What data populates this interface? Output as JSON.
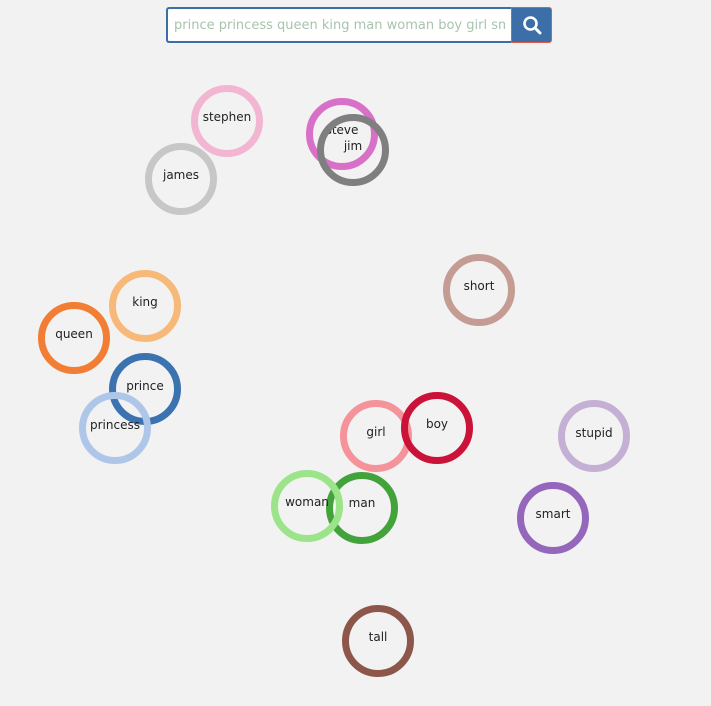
{
  "search": {
    "value": "",
    "placeholder": "prince princess queen king man woman boy girl smart stupid tall short steve jim stephen james",
    "button_icon": "search-icon"
  },
  "words": [
    {
      "id": "stephen",
      "label": "stephen",
      "color": "#f2b6d2"
    },
    {
      "id": "steve",
      "label": "steve",
      "color": "#d870c8"
    },
    {
      "id": "jim",
      "label": "jim",
      "color": "#7f7f7f"
    },
    {
      "id": "james",
      "label": "james",
      "color": "#c7c7c7"
    },
    {
      "id": "short",
      "label": "short",
      "color": "#c49c94"
    },
    {
      "id": "king",
      "label": "king",
      "color": "#f7b979"
    },
    {
      "id": "queen",
      "label": "queen",
      "color": "#f27d34"
    },
    {
      "id": "prince",
      "label": "prince",
      "color": "#3b72b0"
    },
    {
      "id": "princess",
      "label": "princess",
      "color": "#aec7e8"
    },
    {
      "id": "girl",
      "label": "girl",
      "color": "#f4939a"
    },
    {
      "id": "boy",
      "label": "boy",
      "color": "#cb1238"
    },
    {
      "id": "stupid",
      "label": "stupid",
      "color": "#c5b0d5"
    },
    {
      "id": "man",
      "label": "man",
      "color": "#43a33b"
    },
    {
      "id": "woman",
      "label": "woman",
      "color": "#9be48a"
    },
    {
      "id": "smart",
      "label": "smart",
      "color": "#9467bd"
    },
    {
      "id": "tall",
      "label": "tall",
      "color": "#8c564b"
    }
  ]
}
